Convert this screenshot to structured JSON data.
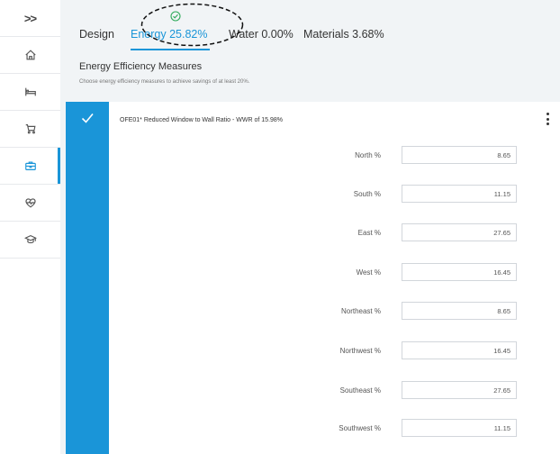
{
  "sidebar": {
    "toggle": ">>",
    "items": [
      {
        "icon": "home-icon",
        "active": false
      },
      {
        "icon": "bed-icon",
        "active": false
      },
      {
        "icon": "cart-icon",
        "active": false
      },
      {
        "icon": "toolbox-icon",
        "active": true
      },
      {
        "icon": "heart-pulse-icon",
        "active": false
      },
      {
        "icon": "graduation-cap-icon",
        "active": false
      }
    ]
  },
  "tabs": [
    {
      "label": "Design",
      "active": false
    },
    {
      "label": "Energy 25.82%",
      "active": true
    },
    {
      "label": "Water 0.00%",
      "active": false
    },
    {
      "label": "Materials 3.68%",
      "active": false
    }
  ],
  "section": {
    "title": "Energy Efficiency Measures",
    "subtitle": "Choose energy efficiency measures to achieve savings of at least 20%."
  },
  "measure": {
    "title": "OFE01*   Reduced Window to Wall Ratio - WWR of 15.98%",
    "checked": true,
    "rows": [
      {
        "label": "North %",
        "value": "8.65"
      },
      {
        "label": "South %",
        "value": "11.15"
      },
      {
        "label": "East %",
        "value": "27.65"
      },
      {
        "label": "West %",
        "value": "16.45"
      },
      {
        "label": "Northeast %",
        "value": "8.65"
      },
      {
        "label": "Northwest %",
        "value": "16.45"
      },
      {
        "label": "Southeast %",
        "value": "27.65"
      },
      {
        "label": "Southwest %",
        "value": "11.15"
      }
    ]
  },
  "colors": {
    "accent": "#1a95d8",
    "background": "#f1f4f6"
  }
}
